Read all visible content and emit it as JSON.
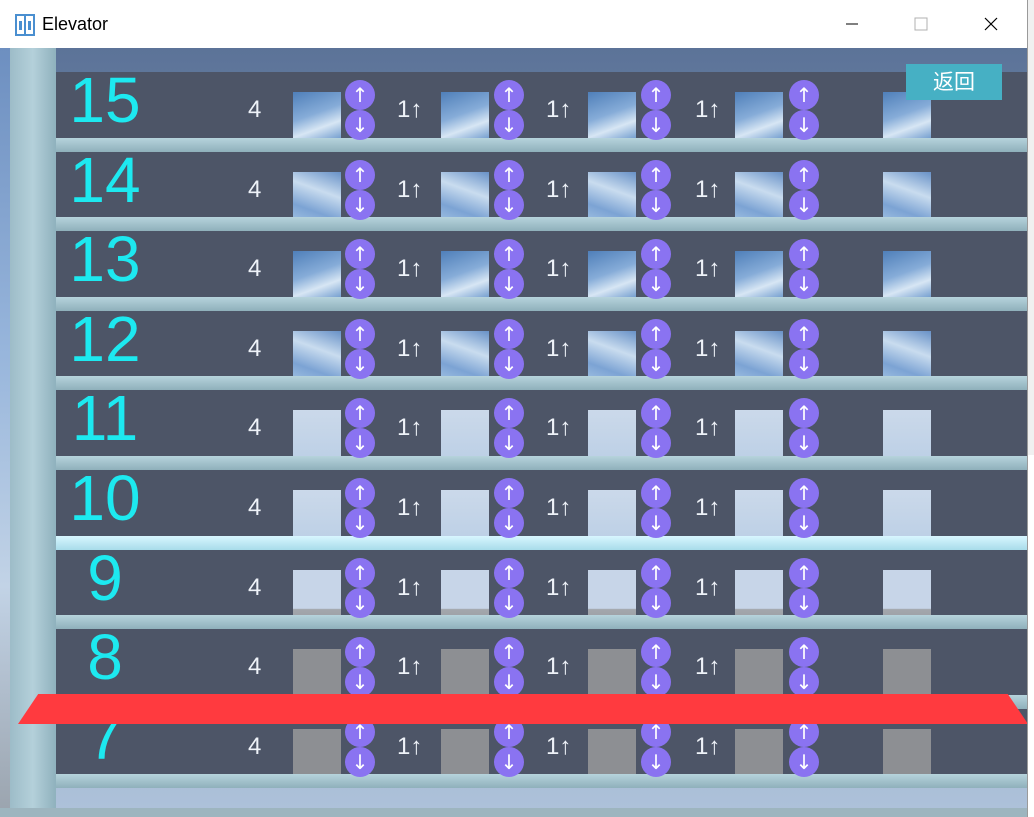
{
  "window": {
    "title": "Elevator",
    "minimize_symbol": "—",
    "maximize_symbol": "□",
    "close_symbol": "✕"
  },
  "back_label": "返回",
  "floors": [
    {
      "number": "15",
      "style": "sky",
      "counts": [
        "4",
        "1↑",
        "1↑",
        "1↑"
      ]
    },
    {
      "number": "14",
      "style": "sky2",
      "counts": [
        "4",
        "1↑",
        "1↑",
        "1↑"
      ]
    },
    {
      "number": "13",
      "style": "sky",
      "counts": [
        "4",
        "1↑",
        "1↑",
        "1↑"
      ]
    },
    {
      "number": "12",
      "style": "sky2",
      "counts": [
        "4",
        "1↑",
        "1↑",
        "1↑"
      ]
    },
    {
      "number": "11",
      "style": "light",
      "counts": [
        "4",
        "1↑",
        "1↑",
        "1↑"
      ]
    },
    {
      "number": "10",
      "style": "light",
      "counts": [
        "4",
        "1↑",
        "1↑",
        "1↑"
      ]
    },
    {
      "number": "9",
      "style": "pale",
      "counts": [
        "4",
        "1↑",
        "1↑",
        "1↑"
      ]
    },
    {
      "number": "8",
      "style": "gray",
      "counts": [
        "4",
        "1↑",
        "1↑",
        "1↑"
      ]
    },
    {
      "number": "7",
      "style": "gray",
      "counts": [
        "4",
        "1↑",
        "1↑",
        "1↑"
      ]
    }
  ],
  "call_button": {
    "up": "↑",
    "down": "↓"
  },
  "highlight_floor": "8",
  "colors": {
    "floor_label": "#1de9f0",
    "call_button": "#8a73f1",
    "highlight_slab": "#ff3a3f",
    "back_button": "#46b0c4"
  },
  "icons": {
    "app": "elevator-icon"
  }
}
